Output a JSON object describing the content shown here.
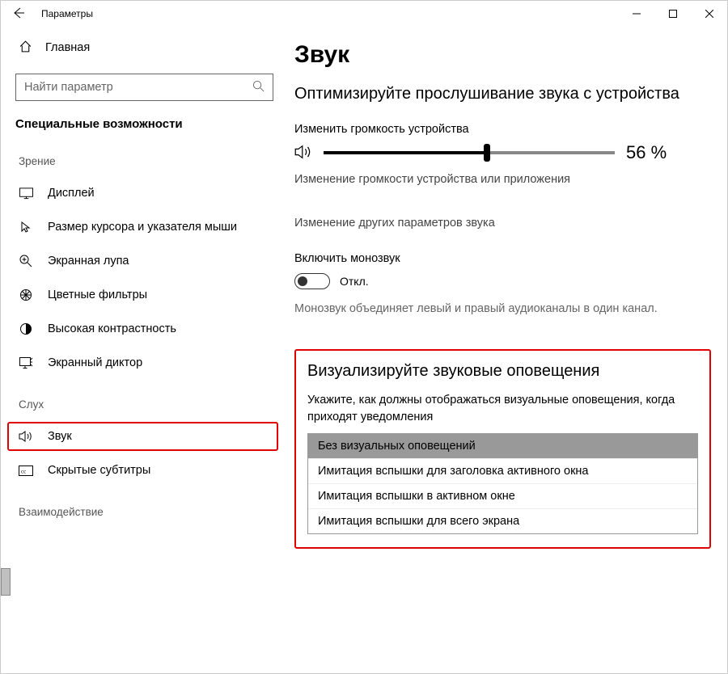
{
  "titlebar": {
    "title": "Параметры"
  },
  "sidebar": {
    "home": "Главная",
    "search_placeholder": "Найти параметр",
    "category_title": "Специальные возможности",
    "groups": {
      "vision": {
        "label": "Зрение",
        "items": [
          {
            "label": "Дисплей"
          },
          {
            "label": "Размер курсора и указателя мыши"
          },
          {
            "label": "Экранная лупа"
          },
          {
            "label": "Цветные фильтры"
          },
          {
            "label": "Высокая контрастность"
          },
          {
            "label": "Экранный диктор"
          }
        ]
      },
      "hearing": {
        "label": "Слух",
        "items": [
          {
            "label": "Звук"
          },
          {
            "label": "Скрытые субтитры"
          }
        ]
      },
      "interaction": {
        "label": "Взаимодействие"
      }
    }
  },
  "main": {
    "title": "Звук",
    "optimize_heading": "Оптимизируйте прослушивание звука с устройства",
    "volume_label": "Изменить громкость устройства",
    "volume_percent": "56 %",
    "volume_value": 56,
    "link_app_volume": "Изменение громкости устройства или приложения",
    "link_other_sound": "Изменение других параметров звука",
    "mono_label": "Включить монозвук",
    "toggle_state": "Откл.",
    "mono_note": "Монозвук объединяет левый и правый аудиоканалы в один канал.",
    "visual_alerts": {
      "heading": "Визуализируйте звуковые оповещения",
      "desc": "Укажите, как должны отображаться визуальные оповещения, когда приходят уведомления",
      "options": [
        "Без визуальных оповещений",
        "Имитация вспышки для заголовка активного окна",
        "Имитация вспышки в активном окне",
        "Имитация вспышки для всего экрана"
      ]
    }
  }
}
